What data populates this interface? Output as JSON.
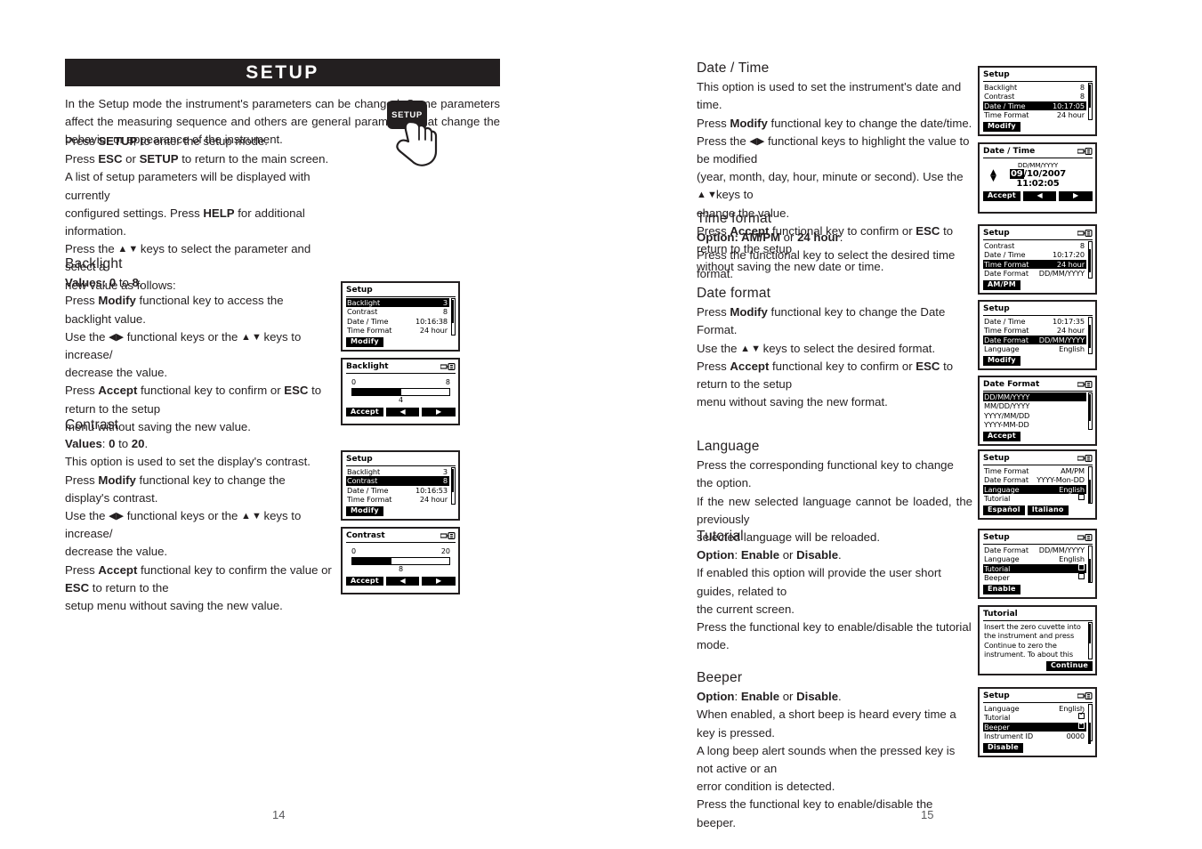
{
  "left_page": {
    "page_number": "14",
    "section_title": "SETUP",
    "intro": "In the Setup mode the instrument's parameters can be changed. Some parameters affect the measuring sequence and others are general parameters that change the behavior or appearance of the instrument.",
    "lines": [
      "Press <b>SETUP</b> to enter the setup mode.",
      "Press <b>ESC</b> or <b>SETUP</b> to return to the main screen.",
      "A list of setup parameters will be displayed with currently",
      "configured settings. Press <b>HELP</b> for additional information.",
      "Press the <span class='sym'>▲ ▼</span> keys to select the parameter and select a",
      "new value as follows:"
    ],
    "setup_key_label": "SETUP",
    "backlight": {
      "heading": "Backlight",
      "values_line": "<b>Values:</b> <b>0</b> to <b>8</b>.",
      "body": [
        "Press <b>Modify</b> functional key to access the backlight value.",
        "Use the <span class='symd'>◀▶</span> functional keys or the <span class='sym'>▲ ▼</span> keys to increase/",
        "decrease the value.",
        "Press <b>Accept</b> functional key to confirm or <b>ESC</b> to return to the setup",
        "menu without saving the new value."
      ]
    },
    "contrast": {
      "heading": "Contrast",
      "values_line": "<b>Values</b>: <b>0</b> to <b>20</b>.",
      "body": [
        "This option is used to set the display's contrast.",
        "Press <b>Modify</b> functional key to change the display's contrast.",
        "Use the <span class='symd'>◀▶</span> functional keys or the <span class='sym'>▲ ▼</span> keys to increase/",
        "decrease the value.",
        "Press <b>Accept</b> functional key to confirm the value or <b>ESC</b> to return to the",
        "setup menu without saving the new value."
      ]
    }
  },
  "right_page": {
    "page_number": "15",
    "date_time": {
      "heading": "Date / Time",
      "body": [
        "This option is used to set the instrument's date and time.",
        "Press <b>Modify</b>  functional key to change the date/time.",
        "Press the <span class='symd'>◀▶</span> functional keys to highlight the value to be modified",
        "(year, month, day, hour, minute or second). Use the <span class='sym'>▲ ▼</span>keys to",
        "change the value.",
        "Press <b>Accept</b> functional key to confirm or <b>ESC</b> to return to the setup",
        "without saving the new date or time."
      ]
    },
    "time_format": {
      "heading": "Time format",
      "option_line": "<b>Option: AM/PM</b> or <b>24 hour</b>.",
      "body": [
        "Press the functional key to select the desired time format."
      ]
    },
    "date_format": {
      "heading": "Date format",
      "body": [
        "Press <b>Modify</b> functional key to change the Date Format.",
        "Use the <span class='sym'>▲ ▼</span> keys to select the desired format.",
        "Press <b>Accept</b> functional key to confirm or <b>ESC</b> to return to the setup",
        "menu without saving the new format."
      ]
    },
    "language": {
      "heading": "Language",
      "body": [
        "Press the corresponding functional key to change the option.",
        "If the new selected language cannot be loaded, the previously",
        "selected language will be reloaded."
      ]
    },
    "tutorial": {
      "heading": "Tutorial",
      "option_line": "<b>Option</b>: <b>Enable</b> or <b>Disable</b>.",
      "body": [
        "If enabled this option will provide the user short guides, related to",
        "the current screen.",
        "Press the functional key to enable/disable the tutorial mode."
      ]
    },
    "beeper": {
      "heading": "Beeper",
      "option_line": "<b>Option</b>: <b>Enable</b> or <b>Disable</b>.",
      "body": [
        "When enabled, a short beep is heard every time a key is pressed.",
        "A long beep alert sounds when the pressed key is not active or an",
        "error condition is detected.",
        "Press the functional key to enable/disable the beeper."
      ]
    }
  },
  "screens": {
    "setup_backlight": {
      "title": "Setup",
      "rows": [
        {
          "label": "Backlight",
          "value": "3",
          "selected": true
        },
        {
          "label": "Contrast",
          "value": "8",
          "selected": false
        },
        {
          "label": "Date / Time",
          "value": "10:16:38",
          "selected": false
        },
        {
          "label": "Time Format",
          "value": "24 hour",
          "selected": false
        }
      ],
      "softkeys": [
        "Modify"
      ]
    },
    "backlight_slider": {
      "title": "Backlight",
      "min": "0",
      "max": "8",
      "value": "4",
      "fill_percent": 50,
      "softkeys": [
        "Accept",
        "◀",
        "▶"
      ]
    },
    "setup_contrast": {
      "title": "Setup",
      "rows": [
        {
          "label": "Backlight",
          "value": "3",
          "selected": false
        },
        {
          "label": "Contrast",
          "value": "8",
          "selected": true
        },
        {
          "label": "Date / Time",
          "value": "10:16:53",
          "selected": false
        },
        {
          "label": "Time Format",
          "value": "24 hour",
          "selected": false
        }
      ],
      "softkeys": [
        "Modify"
      ]
    },
    "contrast_slider": {
      "title": "Contrast",
      "min": "0",
      "max": "20",
      "value": "8",
      "fill_percent": 40,
      "softkeys": [
        "Accept",
        "◀",
        "▶"
      ]
    },
    "setup_datetime": {
      "title": "Setup",
      "rows": [
        {
          "label": "Backlight",
          "value": "8",
          "selected": false
        },
        {
          "label": "Contrast",
          "value": "8",
          "selected": false
        },
        {
          "label": "Date / Time",
          "value": "10:17:05",
          "selected": true
        },
        {
          "label": "Time Format",
          "value": "24 hour",
          "selected": false
        }
      ],
      "softkeys": [
        "Modify"
      ]
    },
    "datetime_edit": {
      "title": "Date / Time",
      "format_label": "DD/MM/YYYY",
      "date_highlight": "09",
      "date_rest": "/10/2007",
      "time": "11:02:05",
      "softkeys": [
        "Accept",
        "◀",
        "▶"
      ]
    },
    "setup_timeformat": {
      "title": "Setup",
      "rows": [
        {
          "label": "Contrast",
          "value": "8",
          "selected": false
        },
        {
          "label": "Date / Time",
          "value": "10:17:20",
          "selected": false
        },
        {
          "label": "Time Format",
          "value": "24 hour",
          "selected": true
        },
        {
          "label": "Date Format",
          "value": "DD/MM/YYYY",
          "selected": false
        }
      ],
      "softkeys": [
        "AM/PM"
      ]
    },
    "setup_dateformat": {
      "title": "Setup",
      "rows": [
        {
          "label": "Date / Time",
          "value": "10:17:35",
          "selected": false
        },
        {
          "label": "Time Format",
          "value": "24 hour",
          "selected": false
        },
        {
          "label": "Date Format",
          "value": "DD/MM/YYYY",
          "selected": true
        },
        {
          "label": "Language",
          "value": "English",
          "selected": false
        }
      ],
      "softkeys": [
        "Modify"
      ]
    },
    "dateformat_list": {
      "title": "Date Format",
      "rows": [
        {
          "label": "DD/MM/YYYY",
          "value": "",
          "selected": true
        },
        {
          "label": "MM/DD/YYYY",
          "value": "",
          "selected": false
        },
        {
          "label": "YYYY/MM/DD",
          "value": "",
          "selected": false
        },
        {
          "label": "YYYY-MM-DD",
          "value": "",
          "selected": false
        }
      ],
      "softkeys": [
        "Accept"
      ]
    },
    "setup_language": {
      "title": "Setup",
      "rows": [
        {
          "label": "Time Format",
          "value": "AM/PM",
          "selected": false
        },
        {
          "label": "Date Format",
          "value": "YYYY-Mon-DD",
          "selected": false
        },
        {
          "label": "Language",
          "value": "English",
          "selected": true
        },
        {
          "label": "Tutorial",
          "value": "checkbox_off",
          "selected": false
        }
      ],
      "softkeys": [
        "Español",
        "Italiano"
      ]
    },
    "setup_tutorial": {
      "title": "Setup",
      "rows": [
        {
          "label": "Date Format",
          "value": "DD/MM/YYYY",
          "selected": false
        },
        {
          "label": "Language",
          "value": "English",
          "selected": false
        },
        {
          "label": "Tutorial",
          "value": "checkbox_off",
          "selected": true
        },
        {
          "label": "Beeper",
          "value": "checkbox_off",
          "selected": false
        }
      ],
      "softkeys": [
        "Enable"
      ]
    },
    "tutorial_popup": {
      "title": "Tutorial",
      "lines": [
        "Insert the zero cuvette into",
        "the instrument and press",
        "Continue to zero the",
        "instrument.  To about this"
      ],
      "softkeys": [
        "Continue"
      ]
    },
    "setup_beeper": {
      "title": "Setup",
      "rows": [
        {
          "label": "Language",
          "value": "English",
          "selected": false
        },
        {
          "label": "Tutorial",
          "value": "checkbox_on",
          "selected": false
        },
        {
          "label": "Beeper",
          "value": "checkbox_on",
          "selected": true
        },
        {
          "label": "Instrument ID",
          "value": "0000",
          "selected": false
        }
      ],
      "softkeys": [
        "Disable"
      ]
    }
  }
}
